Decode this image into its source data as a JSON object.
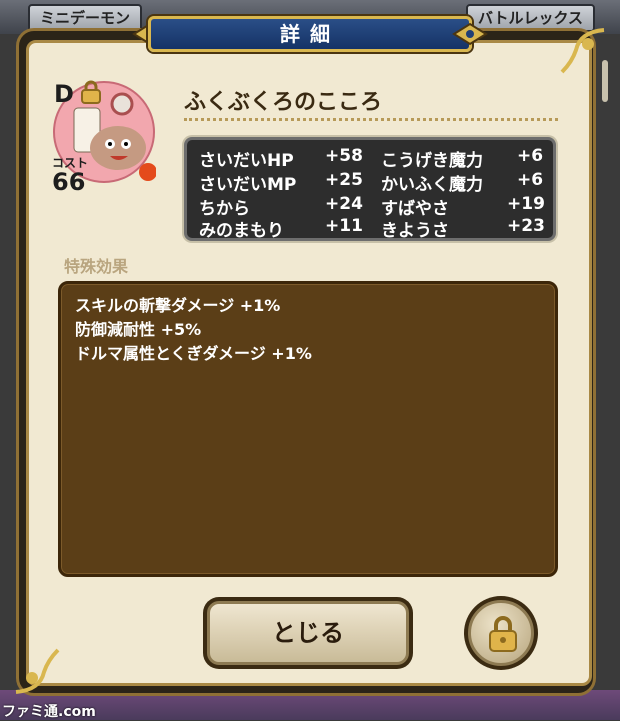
{
  "background": {
    "left_tab": "ミニデーモン",
    "right_tab": "バトルレックス"
  },
  "header": {
    "title": "詳細"
  },
  "item": {
    "rank": "D",
    "cost_label": "コスト",
    "cost_value": "66",
    "name": "ふくぶくろのこころ"
  },
  "stats": [
    {
      "label": "さいだいHP",
      "value": "+58"
    },
    {
      "label": "こうげき魔力",
      "value": "+6"
    },
    {
      "label": "さいだいMP",
      "value": "+25"
    },
    {
      "label": "かいふく魔力",
      "value": "+6"
    },
    {
      "label": "ちから",
      "value": "+24"
    },
    {
      "label": "すばやさ",
      "value": "+19"
    },
    {
      "label": "みのまもり",
      "value": "+11"
    },
    {
      "label": "きようさ",
      "value": "+23"
    }
  ],
  "special": {
    "label": "特殊効果",
    "effects": [
      "スキルの斬撃ダメージ +1%",
      "防御減耐性 +5%",
      "ドルマ属性とくぎダメージ +1%"
    ]
  },
  "buttons": {
    "close_label": "とじる",
    "lock_icon": "padlock-icon"
  },
  "watermark": "ファミ通.com",
  "colors": {
    "header_blue": "#1f3f76",
    "panel_cream": "#f1e9d2",
    "effects_brown": "#5b3e17",
    "stats_dark": "#2d2d2d",
    "gold_frame": "#d9b74f"
  }
}
